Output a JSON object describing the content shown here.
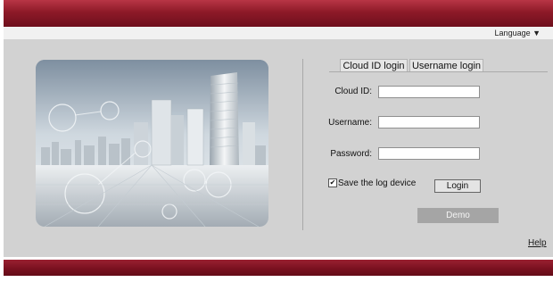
{
  "header": {
    "language_label": "Language ▼"
  },
  "login": {
    "tabs": [
      {
        "label": "Cloud ID login"
      },
      {
        "label": "Username login"
      }
    ],
    "fields": {
      "cloud_id": {
        "label": "Cloud ID:",
        "value": ""
      },
      "username": {
        "label": "Username:",
        "value": ""
      },
      "password": {
        "label": "Password:",
        "value": ""
      }
    },
    "save_log_device": {
      "label": "Save the log device",
      "checked": true,
      "check_mark": "✔"
    },
    "login_button": "Login",
    "demo_button": "Demo"
  },
  "footer": {
    "help_link": "Help"
  },
  "colors": {
    "header_red": "#8d1a28",
    "panel_gray": "#d2d2d2",
    "demo_button": "#a5a5a5"
  },
  "illustration": {
    "icon": "city-skyline-illustration"
  }
}
